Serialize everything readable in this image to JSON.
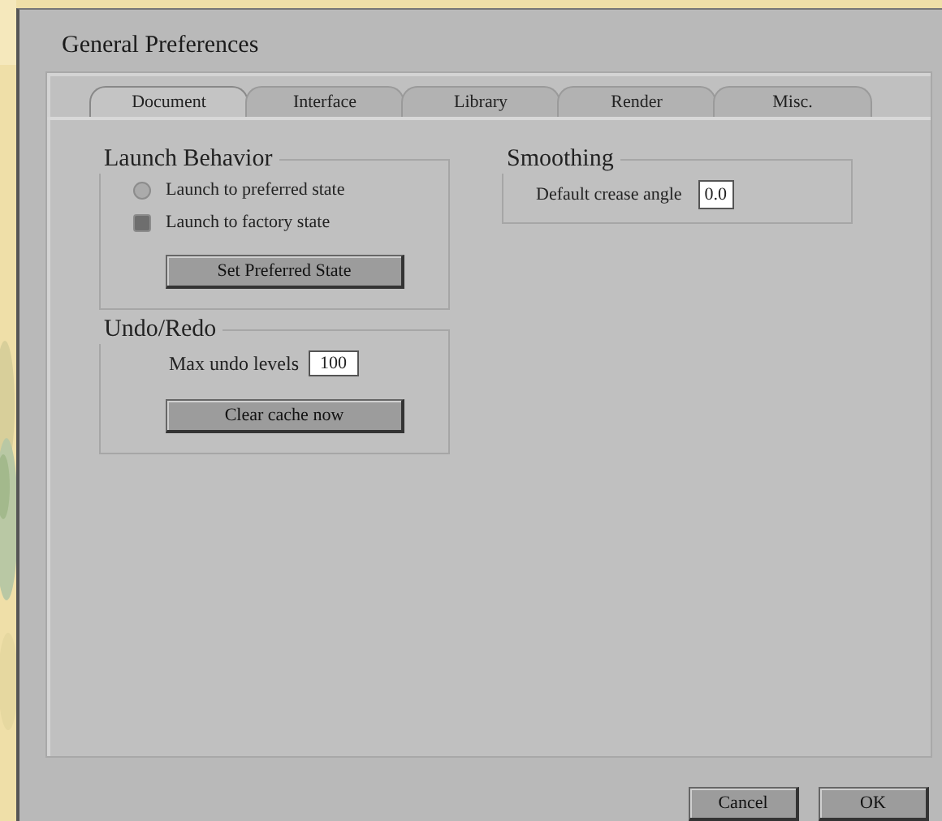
{
  "window": {
    "title": "General Preferences"
  },
  "tabs": [
    {
      "label": "Document",
      "selected": true
    },
    {
      "label": "Interface",
      "selected": false
    },
    {
      "label": "Library",
      "selected": false
    },
    {
      "label": "Render",
      "selected": false
    },
    {
      "label": "Misc.",
      "selected": false
    }
  ],
  "launch_behavior": {
    "title": "Launch Behavior",
    "options": [
      {
        "label": "Launch to preferred state",
        "selected": false
      },
      {
        "label": "Launch to factory state",
        "selected": true
      }
    ],
    "button": "Set Preferred State"
  },
  "undo_redo": {
    "title": "Undo/Redo",
    "label": "Max undo levels",
    "value": "100",
    "button": "Clear cache now"
  },
  "smoothing": {
    "title": "Smoothing",
    "label": "Default crease angle",
    "value": "0.0"
  },
  "buttons": [
    "Cancel",
    "OK"
  ]
}
